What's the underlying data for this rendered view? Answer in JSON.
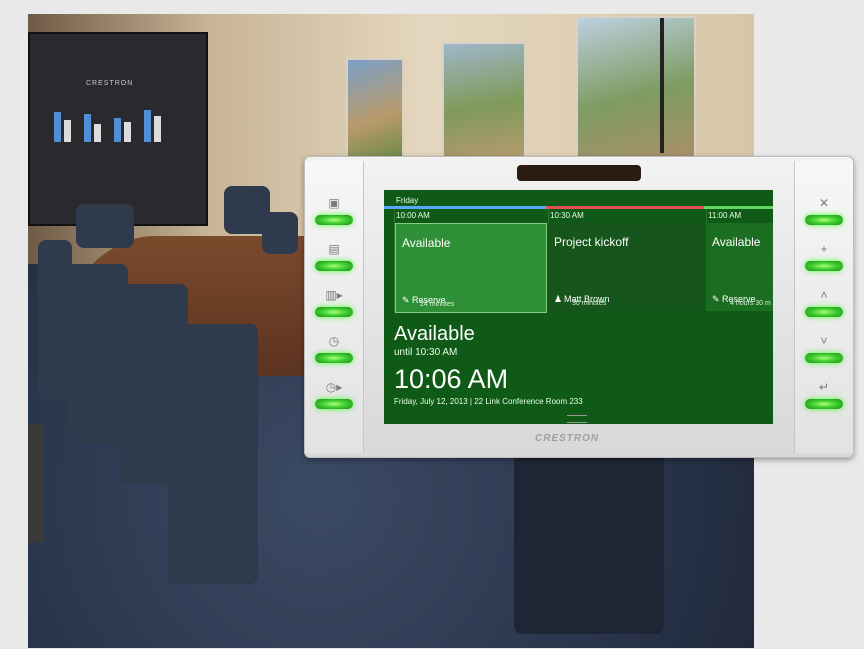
{
  "projector": {
    "brand": "CRESTRON"
  },
  "panel": {
    "logo": "CRESTRON",
    "left_keys": [
      {
        "icon": "calendar-day-icon"
      },
      {
        "icon": "calendar-week-icon"
      },
      {
        "icon": "calendar-next-icon"
      },
      {
        "icon": "clock-icon"
      },
      {
        "icon": "clock-forward-icon"
      }
    ],
    "right_keys": [
      {
        "icon": "close-icon"
      },
      {
        "icon": "plus-icon"
      },
      {
        "icon": "up-icon"
      },
      {
        "icon": "down-icon"
      },
      {
        "icon": "enter-icon"
      }
    ],
    "led_color": "#3fcf2f"
  },
  "schedule": {
    "day": "Friday",
    "times": [
      "10:00 AM",
      "10:30 AM",
      "11:00 AM"
    ],
    "timeline_colors": [
      "#5aa7ff",
      "#e05050",
      "#62d562"
    ],
    "slots": [
      {
        "title": "Available",
        "action": "Reserve",
        "detail": "24 minutes"
      },
      {
        "title": "Project kickoff",
        "action": "Matt Brown",
        "detail": "30 minutes"
      },
      {
        "title": "Available",
        "action": "Reserve",
        "detail": "4 hours 30 m"
      }
    ]
  },
  "status": {
    "state": "Available",
    "until": "until 10:30 AM",
    "clock": "10:06 AM",
    "meta": "Friday, July 12, 2013  |  22 Link Conference Room 233"
  }
}
